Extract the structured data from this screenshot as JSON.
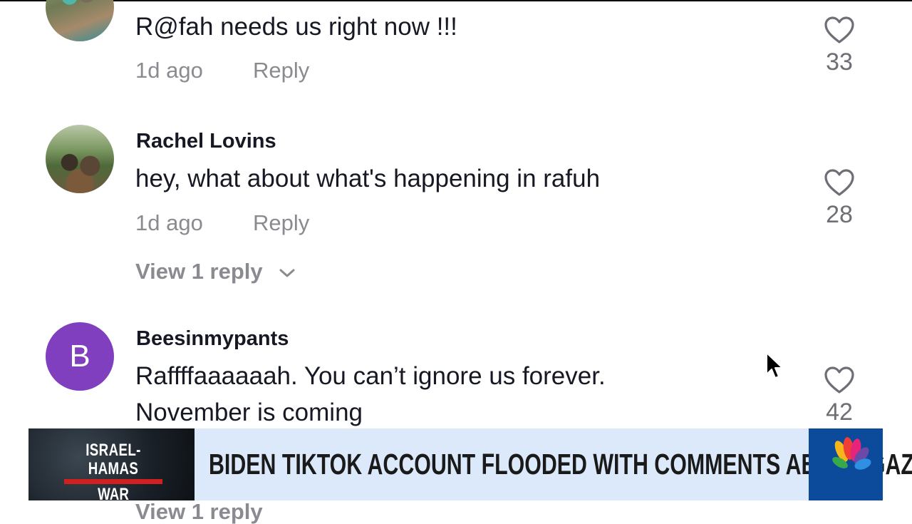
{
  "comments": [
    {
      "avatar": "photo-avatar",
      "text": "R@fah needs us right now !!!",
      "time": "1d ago",
      "reply_label": "Reply",
      "likes": "33"
    },
    {
      "avatar": "photo-avatar",
      "username": "Rachel Lovins",
      "text": "hey, what about what's happening in rafuh",
      "time": "1d ago",
      "reply_label": "Reply",
      "likes": "28",
      "view_replies": "View 1 reply"
    },
    {
      "avatar": "letter-avatar",
      "avatar_letter": "B",
      "username": "Beesinmypants",
      "text_line1": "Raffffaaaaaah. You can’t ignore us forever.",
      "text_line2": "November is coming",
      "likes": "42",
      "view_replies": "View 1 reply"
    }
  ],
  "lower_third": {
    "tag_line1": "ISRAEL-HAMAS",
    "tag_line2": "WAR",
    "headline": "BIDEN TIKTOK ACCOUNT FLOODED WITH COMMENTS ABOUT GAZA",
    "logo": "network-peacock-logo"
  },
  "colors": {
    "text": "#161823",
    "muted": "#8a8b91",
    "avatar_letter_bg": "#7f3fbf",
    "lower_third_bg": "#dbe9fb",
    "logo_bg": "#0c4a9c",
    "tag_red": "#d21f1f"
  },
  "icons": [
    "heart-icon",
    "chevron-down-icon",
    "mouse-cursor-icon"
  ]
}
